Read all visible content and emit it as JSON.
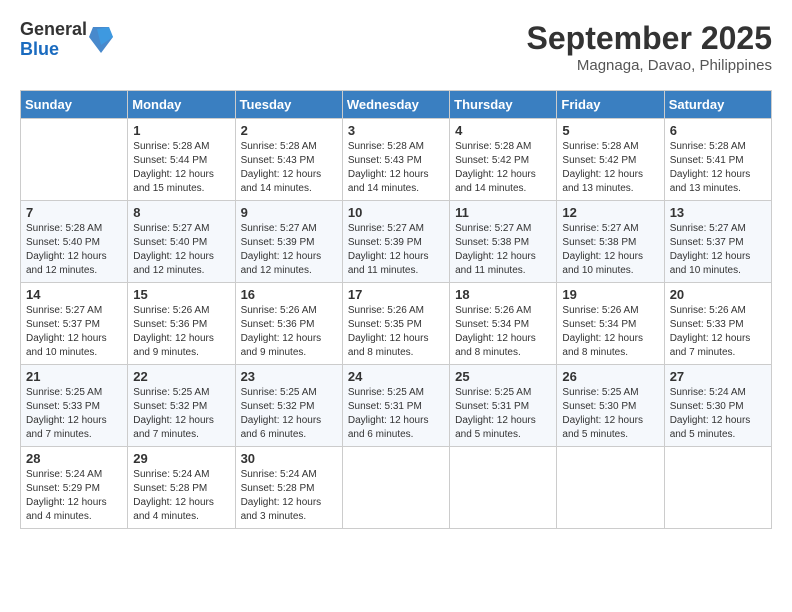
{
  "header": {
    "logo_general": "General",
    "logo_blue": "Blue",
    "month_year": "September 2025",
    "location": "Magnaga, Davao, Philippines"
  },
  "days_of_week": [
    "Sunday",
    "Monday",
    "Tuesday",
    "Wednesday",
    "Thursday",
    "Friday",
    "Saturday"
  ],
  "weeks": [
    [
      {
        "day": "",
        "info": ""
      },
      {
        "day": "1",
        "info": "Sunrise: 5:28 AM\nSunset: 5:44 PM\nDaylight: 12 hours\nand 15 minutes."
      },
      {
        "day": "2",
        "info": "Sunrise: 5:28 AM\nSunset: 5:43 PM\nDaylight: 12 hours\nand 14 minutes."
      },
      {
        "day": "3",
        "info": "Sunrise: 5:28 AM\nSunset: 5:43 PM\nDaylight: 12 hours\nand 14 minutes."
      },
      {
        "day": "4",
        "info": "Sunrise: 5:28 AM\nSunset: 5:42 PM\nDaylight: 12 hours\nand 14 minutes."
      },
      {
        "day": "5",
        "info": "Sunrise: 5:28 AM\nSunset: 5:42 PM\nDaylight: 12 hours\nand 13 minutes."
      },
      {
        "day": "6",
        "info": "Sunrise: 5:28 AM\nSunset: 5:41 PM\nDaylight: 12 hours\nand 13 minutes."
      }
    ],
    [
      {
        "day": "7",
        "info": "Sunrise: 5:28 AM\nSunset: 5:40 PM\nDaylight: 12 hours\nand 12 minutes."
      },
      {
        "day": "8",
        "info": "Sunrise: 5:27 AM\nSunset: 5:40 PM\nDaylight: 12 hours\nand 12 minutes."
      },
      {
        "day": "9",
        "info": "Sunrise: 5:27 AM\nSunset: 5:39 PM\nDaylight: 12 hours\nand 12 minutes."
      },
      {
        "day": "10",
        "info": "Sunrise: 5:27 AM\nSunset: 5:39 PM\nDaylight: 12 hours\nand 11 minutes."
      },
      {
        "day": "11",
        "info": "Sunrise: 5:27 AM\nSunset: 5:38 PM\nDaylight: 12 hours\nand 11 minutes."
      },
      {
        "day": "12",
        "info": "Sunrise: 5:27 AM\nSunset: 5:38 PM\nDaylight: 12 hours\nand 10 minutes."
      },
      {
        "day": "13",
        "info": "Sunrise: 5:27 AM\nSunset: 5:37 PM\nDaylight: 12 hours\nand 10 minutes."
      }
    ],
    [
      {
        "day": "14",
        "info": "Sunrise: 5:27 AM\nSunset: 5:37 PM\nDaylight: 12 hours\nand 10 minutes."
      },
      {
        "day": "15",
        "info": "Sunrise: 5:26 AM\nSunset: 5:36 PM\nDaylight: 12 hours\nand 9 minutes."
      },
      {
        "day": "16",
        "info": "Sunrise: 5:26 AM\nSunset: 5:36 PM\nDaylight: 12 hours\nand 9 minutes."
      },
      {
        "day": "17",
        "info": "Sunrise: 5:26 AM\nSunset: 5:35 PM\nDaylight: 12 hours\nand 8 minutes."
      },
      {
        "day": "18",
        "info": "Sunrise: 5:26 AM\nSunset: 5:34 PM\nDaylight: 12 hours\nand 8 minutes."
      },
      {
        "day": "19",
        "info": "Sunrise: 5:26 AM\nSunset: 5:34 PM\nDaylight: 12 hours\nand 8 minutes."
      },
      {
        "day": "20",
        "info": "Sunrise: 5:26 AM\nSunset: 5:33 PM\nDaylight: 12 hours\nand 7 minutes."
      }
    ],
    [
      {
        "day": "21",
        "info": "Sunrise: 5:25 AM\nSunset: 5:33 PM\nDaylight: 12 hours\nand 7 minutes."
      },
      {
        "day": "22",
        "info": "Sunrise: 5:25 AM\nSunset: 5:32 PM\nDaylight: 12 hours\nand 7 minutes."
      },
      {
        "day": "23",
        "info": "Sunrise: 5:25 AM\nSunset: 5:32 PM\nDaylight: 12 hours\nand 6 minutes."
      },
      {
        "day": "24",
        "info": "Sunrise: 5:25 AM\nSunset: 5:31 PM\nDaylight: 12 hours\nand 6 minutes."
      },
      {
        "day": "25",
        "info": "Sunrise: 5:25 AM\nSunset: 5:31 PM\nDaylight: 12 hours\nand 5 minutes."
      },
      {
        "day": "26",
        "info": "Sunrise: 5:25 AM\nSunset: 5:30 PM\nDaylight: 12 hours\nand 5 minutes."
      },
      {
        "day": "27",
        "info": "Sunrise: 5:24 AM\nSunset: 5:30 PM\nDaylight: 12 hours\nand 5 minutes."
      }
    ],
    [
      {
        "day": "28",
        "info": "Sunrise: 5:24 AM\nSunset: 5:29 PM\nDaylight: 12 hours\nand 4 minutes."
      },
      {
        "day": "29",
        "info": "Sunrise: 5:24 AM\nSunset: 5:28 PM\nDaylight: 12 hours\nand 4 minutes."
      },
      {
        "day": "30",
        "info": "Sunrise: 5:24 AM\nSunset: 5:28 PM\nDaylight: 12 hours\nand 3 minutes."
      },
      {
        "day": "",
        "info": ""
      },
      {
        "day": "",
        "info": ""
      },
      {
        "day": "",
        "info": ""
      },
      {
        "day": "",
        "info": ""
      }
    ]
  ]
}
